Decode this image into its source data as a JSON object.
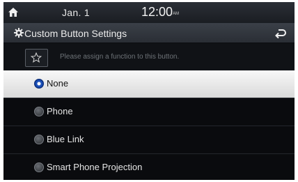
{
  "status_bar": {
    "date": "Jan. 1",
    "time": "12:00",
    "ampm": "AM"
  },
  "header": {
    "title": "Custom Button Settings"
  },
  "hint": {
    "text": "Please assign a function to this button."
  },
  "options": [
    {
      "label": "None",
      "selected": true
    },
    {
      "label": "Phone",
      "selected": false
    },
    {
      "label": "Blue Link",
      "selected": false
    },
    {
      "label": "Smart Phone Projection",
      "selected": false
    }
  ],
  "icons": {
    "home": "home-icon",
    "gear": "gear-icon",
    "back": "back-arrow-icon",
    "star": "star-icon"
  },
  "colors": {
    "selected_radio": "#1b4fb8",
    "selected_row": "#e6e6e6"
  }
}
